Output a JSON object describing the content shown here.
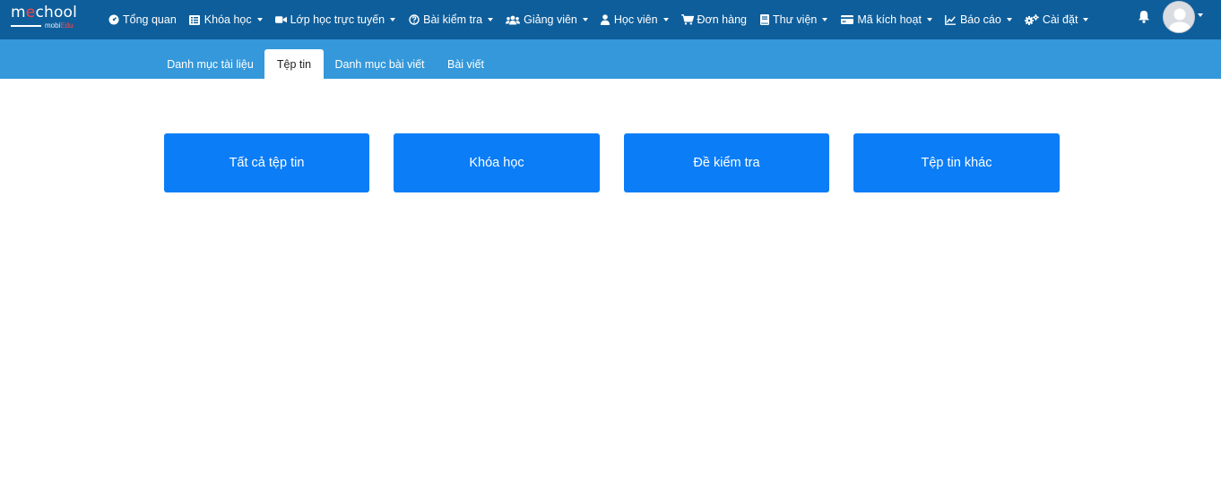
{
  "logo": {
    "brand_prefix": "m",
    "brand_e": "e",
    "brand_suffix": "chool",
    "sub_main": "mobi",
    "sub_accent": "Edu"
  },
  "nav": {
    "items": [
      {
        "label": "Tổng quan",
        "icon": "gauge-icon",
        "dropdown": false
      },
      {
        "label": "Khóa học",
        "icon": "list-icon",
        "dropdown": true
      },
      {
        "label": "Lớp học trực tuyến",
        "icon": "video-camera-icon",
        "dropdown": true
      },
      {
        "label": "Bài kiểm tra",
        "icon": "question-circle-icon",
        "dropdown": true
      },
      {
        "label": "Giảng viên",
        "icon": "users-icon",
        "dropdown": true
      },
      {
        "label": "Học viên",
        "icon": "user-icon",
        "dropdown": true
      },
      {
        "label": "Đơn hàng",
        "icon": "cart-icon",
        "dropdown": false
      },
      {
        "label": "Thư viện",
        "icon": "book-icon",
        "dropdown": true
      },
      {
        "label": "Mã kích hoạt",
        "icon": "credit-card-icon",
        "dropdown": true
      },
      {
        "label": "Báo cáo",
        "icon": "line-chart-icon",
        "dropdown": true
      },
      {
        "label": "Cài đặt",
        "icon": "cogs-icon",
        "dropdown": true
      }
    ]
  },
  "tabs": [
    {
      "label": "Danh mục tài liệu",
      "active": false
    },
    {
      "label": "Tệp tin",
      "active": true
    },
    {
      "label": "Danh mục bài viết",
      "active": false
    },
    {
      "label": "Bài viết",
      "active": false
    }
  ],
  "cards": [
    {
      "label": "Tất cả tệp tin"
    },
    {
      "label": "Khóa học"
    },
    {
      "label": "Đề kiểm tra"
    },
    {
      "label": "Tệp tin khác"
    }
  ],
  "colors": {
    "navbar": "#0e5e9b",
    "subbar": "#3498db",
    "card": "#0a7df7"
  }
}
